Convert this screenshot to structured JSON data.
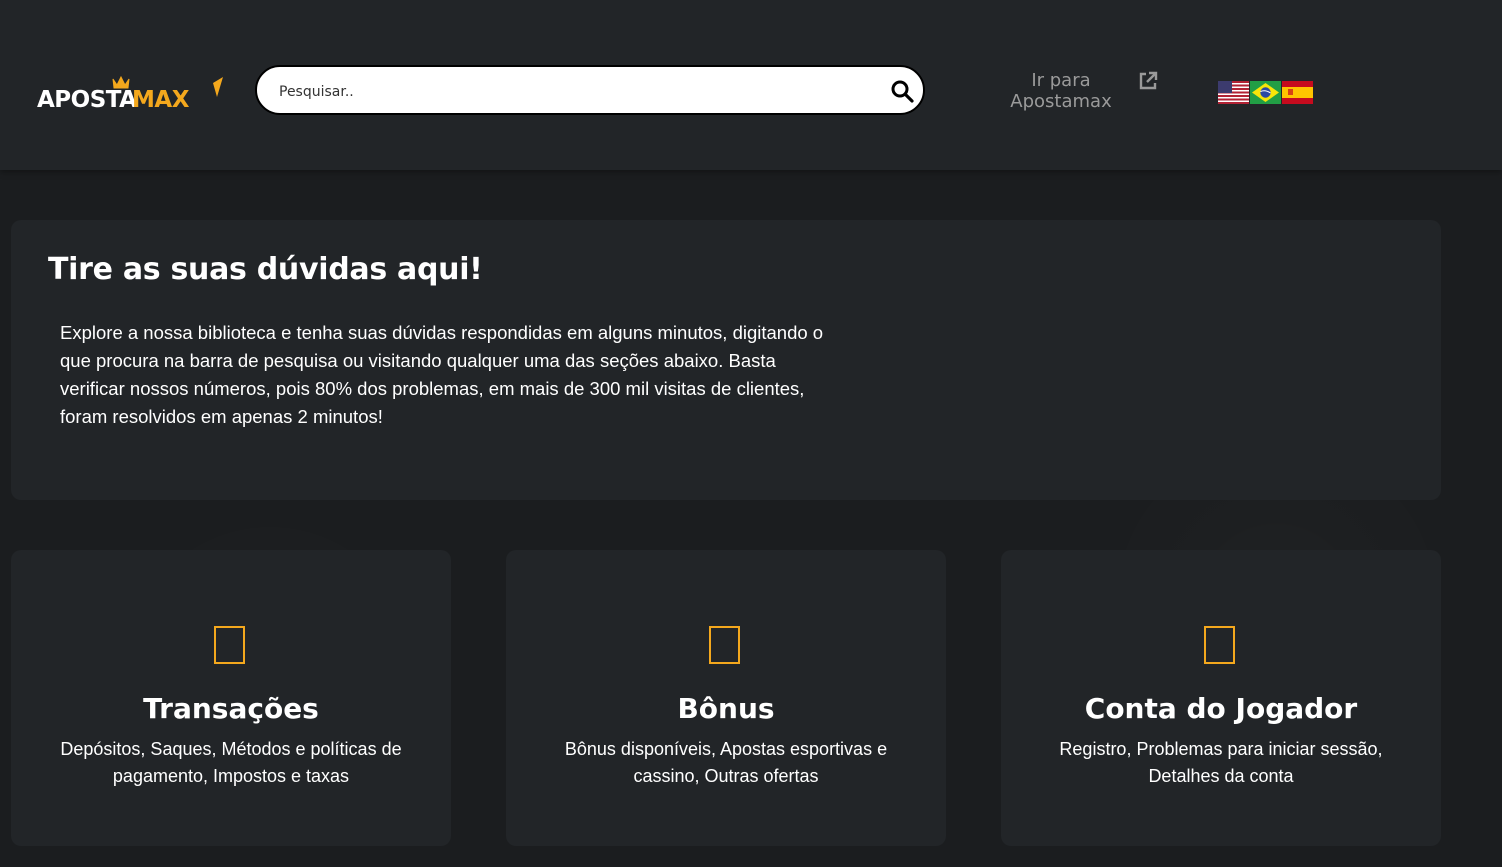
{
  "header": {
    "logo_text_white": "APOSTA",
    "logo_text_orange": "MAX",
    "search": {
      "placeholder": "Pesquisar..",
      "value": ""
    },
    "goto_link": {
      "label_line1": "Ir para",
      "label_line2": "Apostamax"
    },
    "flags": [
      {
        "name": "us-flag-icon",
        "language": "English"
      },
      {
        "name": "br-flag-icon",
        "language": "Português"
      },
      {
        "name": "es-flag-icon",
        "language": "Español"
      }
    ]
  },
  "intro": {
    "title": "Tire as suas dúvidas aqui!",
    "text": "Explore a nossa biblioteca e tenha suas dúvidas respondidas em alguns minutos, digitando o que procura na barra de pesquisa ou visitando qualquer uma das seções abaixo. Basta verificar nossos números, pois 80% dos problemas, em mais de 300 mil visitas de clientes, foram resolvidos em apenas 2 minutos!"
  },
  "categories": [
    {
      "title": "Transações",
      "description": "Depósitos, Saques, Métodos e políticas de pagamento, Impostos e taxas"
    },
    {
      "title": "Bônus",
      "description": "Bônus disponíveis, Apostas esportivas e cassino, Outras ofertas"
    },
    {
      "title": "Conta do Jogador",
      "description": "Registro, Problemas para iniciar sessão, Detalhes da conta"
    }
  ],
  "colors": {
    "accent": "#f4a81d",
    "background": "#1b1d1f",
    "panel": "#222528",
    "muted_text": "#9a9a9a"
  }
}
